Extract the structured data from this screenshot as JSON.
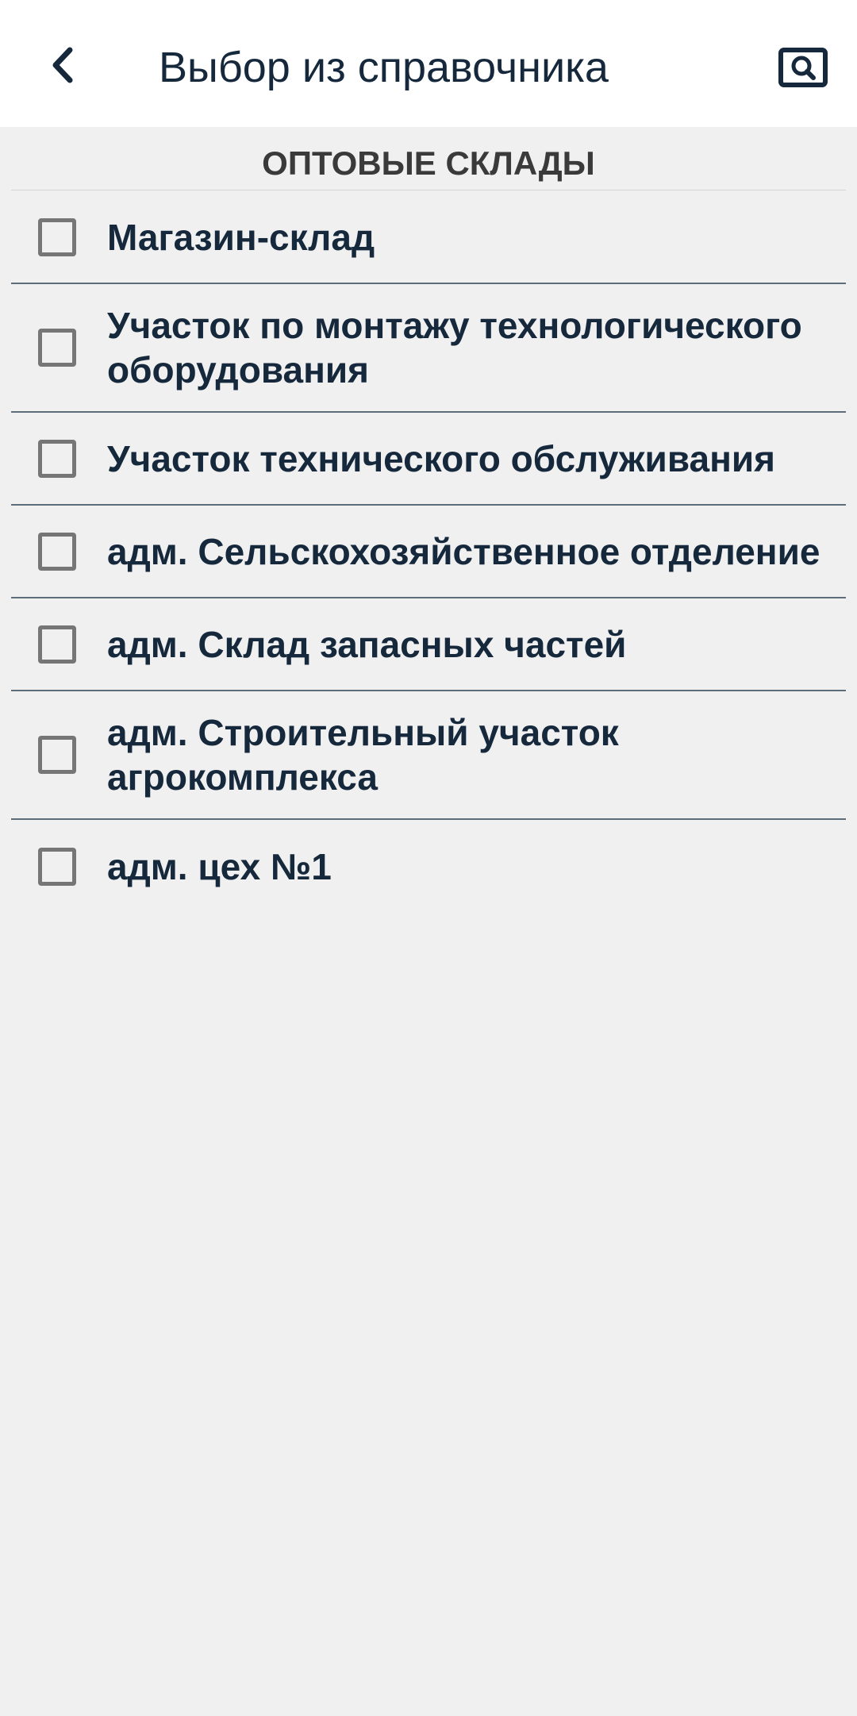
{
  "header": {
    "title": "Выбор из справочника",
    "back_icon": "chevron-left-icon",
    "search_icon": "search-icon"
  },
  "section": {
    "title": "ОПТОВЫЕ СКЛАДЫ"
  },
  "items": [
    {
      "label": "Магазин-склад",
      "checked": false
    },
    {
      "label": "Участок по монтажу технологического оборудования",
      "checked": false
    },
    {
      "label": "Участок технического обслуживания",
      "checked": false
    },
    {
      "label": "адм. Сельскохозяйственное отделение",
      "checked": false
    },
    {
      "label": "адм. Склад запасных частей",
      "checked": false
    },
    {
      "label": "адм. Строительный участок агрокомплекса",
      "checked": false
    },
    {
      "label": "адм. цех №1",
      "checked": false
    }
  ],
  "colors": {
    "text": "#16283b",
    "background": "#f0f0f0",
    "header_background": "#ffffff",
    "checkbox_border": "#767676",
    "divider": "#5d6d7c"
  }
}
